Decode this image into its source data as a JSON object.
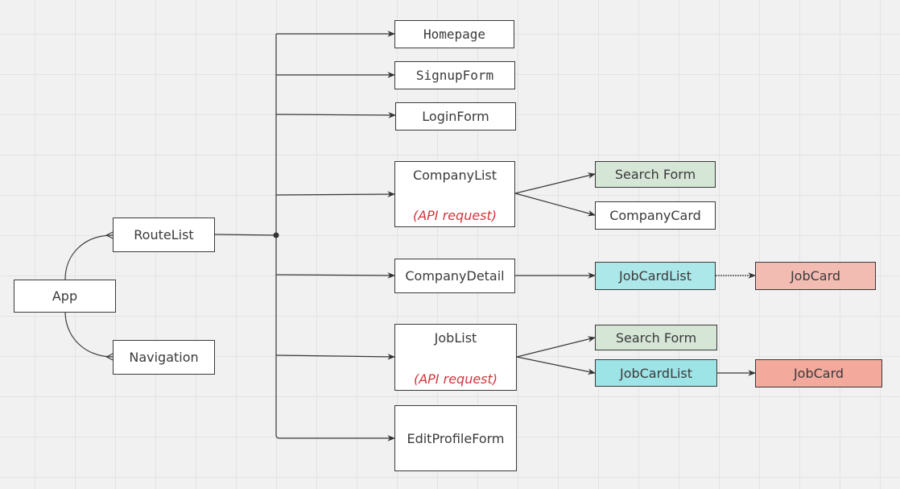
{
  "diagram": {
    "nodes": {
      "app": "App",
      "routelist": "RouteList",
      "navigation": "Navigation",
      "homepage": "Homepage",
      "signupform": "SignupForm",
      "loginform": "LoginForm",
      "companylist": "CompanyList",
      "companylist_note": "(API request)",
      "companydetail": "CompanyDetail",
      "joblist": "JobList",
      "joblist_note": "(API request)",
      "editprofileform": "EditProfileForm",
      "searchform_company": "Search Form",
      "companycard": "CompanyCard",
      "jobcardlist_detail": "JobCardList",
      "jobcard_detail": "JobCard",
      "searchform_job": "Search Form",
      "jobcardlist_job": "JobCardList",
      "jobcard_job": "JobCard"
    },
    "edges": [
      [
        "App",
        "RouteList"
      ],
      [
        "App",
        "Navigation"
      ],
      [
        "RouteList",
        "Homepage"
      ],
      [
        "RouteList",
        "SignupForm"
      ],
      [
        "RouteList",
        "LoginForm"
      ],
      [
        "RouteList",
        "CompanyList"
      ],
      [
        "RouteList",
        "CompanyDetail"
      ],
      [
        "RouteList",
        "JobList"
      ],
      [
        "RouteList",
        "EditProfileForm"
      ],
      [
        "CompanyList",
        "Search Form"
      ],
      [
        "CompanyList",
        "CompanyCard"
      ],
      [
        "CompanyDetail",
        "JobCardList"
      ],
      [
        "JobCardList",
        "JobCard"
      ],
      [
        "JobList",
        "Search Form"
      ],
      [
        "JobList",
        "JobCardList"
      ],
      [
        "JobCardList",
        "JobCard"
      ]
    ],
    "colors": {
      "search_form": "#d5e5d6",
      "jobcardlist": "#9de4e7",
      "jobcard": "#f3a99c",
      "api_note": "#d1353b",
      "stroke": "#3a3a3a"
    }
  }
}
